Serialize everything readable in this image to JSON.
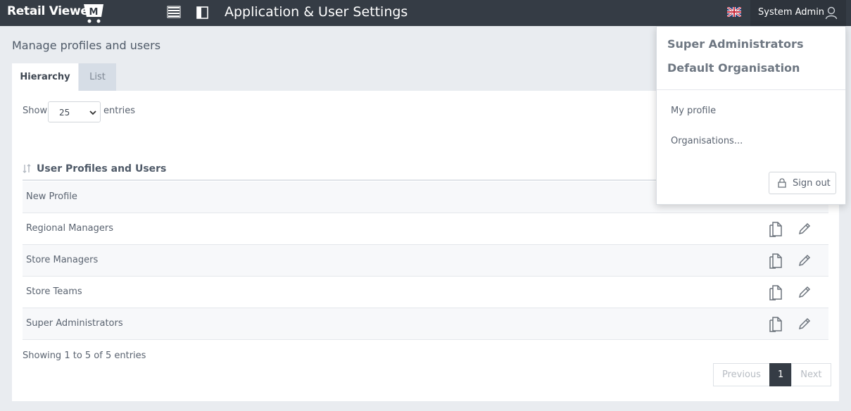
{
  "header": {
    "logo_text": "Retail Viewer",
    "logo_mark": "M",
    "menu_icon": "hamburger-icon",
    "panel_icon": "sidebar-toggle-icon",
    "app_title": "Application & User Settings",
    "language_icon": "uk-flag-icon",
    "user_name": "System Admin",
    "user_icon": "user-icon"
  },
  "page": {
    "title": "Manage profiles and users",
    "tabs": [
      {
        "label": "Hierarchy",
        "active": true
      },
      {
        "label": "List",
        "active": false
      }
    ]
  },
  "table": {
    "show_label": "Show",
    "page_size": "25",
    "entries_label": "entries",
    "column_header": "User Profiles and Users",
    "rows": [
      {
        "label": "New Profile"
      },
      {
        "label": "Regional Managers"
      },
      {
        "label": "Store Managers"
      },
      {
        "label": "Store Teams"
      },
      {
        "label": "Super Administrators"
      }
    ],
    "info": "Showing 1 to 5 of 5 entries",
    "pagination": {
      "previous": "Previous",
      "current": "1",
      "next": "Next"
    }
  },
  "user_menu": {
    "role": "Super Administrators",
    "organisation": "Default Organisation",
    "items": [
      {
        "label": "My profile"
      },
      {
        "label": "Organisations..."
      }
    ],
    "sign_out": "Sign out"
  },
  "colors": {
    "header_bg": "#353c45",
    "page_bg": "#e9ecf0",
    "accent_dark": "#353c45"
  }
}
